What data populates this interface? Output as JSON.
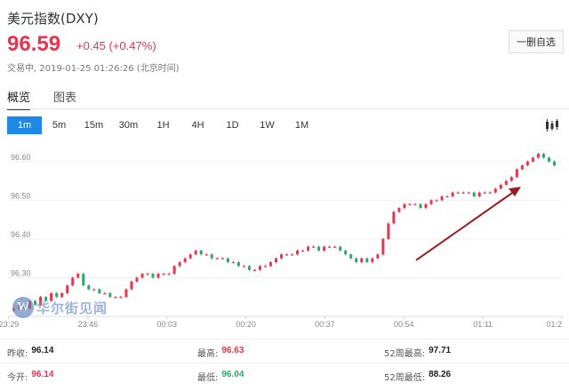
{
  "header": {
    "title": "美元指数(DXY)",
    "price": "96.59",
    "change": "+0.45 (+0.47%)",
    "status": "交易中, 2019-01-25 01:26:26 (北京时间)",
    "watch_label": "一删自选"
  },
  "tabs": [
    {
      "label": "概览",
      "active": true
    },
    {
      "label": "图表",
      "active": false
    }
  ],
  "periods": [
    {
      "label": "1m",
      "active": true
    },
    {
      "label": "5m",
      "active": false
    },
    {
      "label": "15m",
      "active": false
    },
    {
      "label": "30m",
      "active": false
    },
    {
      "label": "1H",
      "active": false
    },
    {
      "label": "4H",
      "active": false
    },
    {
      "label": "1D",
      "active": false
    },
    {
      "label": "1W",
      "active": false
    },
    {
      "label": "1M",
      "active": false
    }
  ],
  "watermark": {
    "logo": "W",
    "text": "华尔街见闻"
  },
  "stats": {
    "prev_close": {
      "label": "昨收:",
      "value": "96.14"
    },
    "open": {
      "label": "今开:",
      "value": "96.14"
    },
    "high": {
      "label": "最高:",
      "value": "96.63"
    },
    "low": {
      "label": "最低:",
      "value": "96.04"
    },
    "high_52w": {
      "label": "52周最高:",
      "value": "97.71"
    },
    "low_52w": {
      "label": "52周最低:",
      "value": "88.26"
    }
  },
  "colors": {
    "up": "#e5364f",
    "down": "#2ea66a",
    "accent": "#1e88e5",
    "arrow": "#9b1c22"
  },
  "chart_data": {
    "type": "candlestick",
    "y_ticks": [
      "96.60",
      "96.50",
      "96.40",
      "96.30"
    ],
    "x_ticks": [
      "23:29",
      "23:46",
      "00:03",
      "00:20",
      "00:37",
      "00:54",
      "01:11",
      "01:2"
    ],
    "ylim": [
      96.2,
      96.65
    ],
    "closes": [
      96.22,
      96.23,
      96.22,
      96.24,
      96.23,
      96.25,
      96.24,
      96.26,
      96.25,
      96.26,
      96.28,
      96.3,
      96.31,
      96.28,
      96.27,
      96.27,
      96.26,
      96.26,
      96.25,
      96.25,
      96.25,
      96.27,
      96.29,
      96.3,
      96.31,
      96.31,
      96.3,
      96.31,
      96.31,
      96.31,
      96.33,
      96.34,
      96.35,
      96.36,
      96.37,
      96.36,
      96.36,
      96.35,
      96.35,
      96.35,
      96.34,
      96.34,
      96.33,
      96.33,
      96.32,
      96.32,
      96.33,
      96.33,
      96.34,
      96.35,
      96.36,
      96.36,
      96.36,
      96.37,
      96.37,
      96.38,
      96.38,
      96.37,
      96.38,
      96.38,
      96.38,
      96.37,
      96.36,
      96.35,
      96.34,
      96.35,
      96.34,
      96.35,
      96.36,
      96.4,
      96.44,
      96.47,
      96.48,
      96.49,
      96.49,
      96.49,
      96.48,
      96.49,
      96.5,
      96.5,
      96.51,
      96.51,
      96.52,
      96.52,
      96.52,
      96.52,
      96.51,
      96.52,
      96.52,
      96.52,
      96.53,
      96.54,
      96.55,
      96.56,
      96.58,
      96.59,
      96.6,
      96.61,
      96.62,
      96.61,
      96.6,
      96.59
    ]
  }
}
